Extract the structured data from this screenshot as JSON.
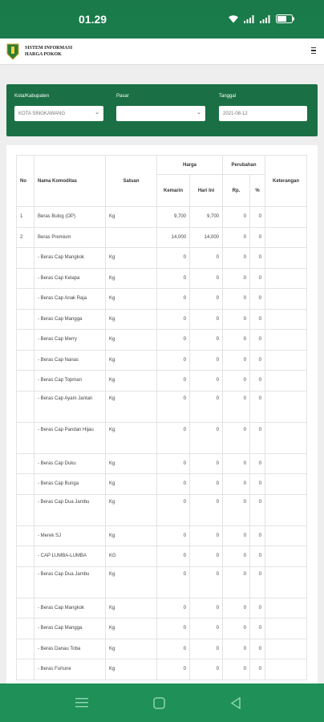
{
  "status_bar": {
    "time": "01.29"
  },
  "header": {
    "brand_line1": "SISTEM INFORMASI",
    "brand_line2": "HARGA POKOK"
  },
  "filters": {
    "kota_label": "Kota/Kabupaten",
    "kota_value": "KOTA SINGKAWANG",
    "pasar_label": "Pasar",
    "pasar_value": "",
    "tanggal_label": "Tanggal",
    "tanggal_value": "2021-08-12"
  },
  "table": {
    "headers": {
      "no": "No",
      "nama": "Nama Komoditas",
      "satuan": "Satuan",
      "harga": "Harga",
      "kemarin": "Kemarin",
      "hari_ini": "Hari Ini",
      "perubahan": "Perubahan",
      "rp": "Rp.",
      "pct": "%",
      "keterangan": "Keterangan"
    },
    "rows": [
      {
        "no": "1",
        "nama": "Beras Bulog (OP)",
        "satuan": "Kg",
        "kemarin": "9,700",
        "hari_ini": "9,700",
        "rp": "0",
        "pct": "0"
      },
      {
        "no": "2",
        "nama": "Beras Premium",
        "satuan": "",
        "kemarin": "14,000",
        "hari_ini": "14,000",
        "rp": "0",
        "pct": "0"
      },
      {
        "no": "",
        "nama": "- Beras Cap Mangkok",
        "satuan": "Kg",
        "kemarin": "0",
        "hari_ini": "0",
        "rp": "0",
        "pct": "0"
      },
      {
        "no": "",
        "nama": "- Beras Cap Kelapa",
        "satuan": "Kg",
        "kemarin": "0",
        "hari_ini": "0",
        "rp": "0",
        "pct": "0"
      },
      {
        "no": "",
        "nama": "- Beras Cap Anak Raja",
        "satuan": "Kg",
        "kemarin": "0",
        "hari_ini": "0",
        "rp": "0",
        "pct": "0"
      },
      {
        "no": "",
        "nama": "- Beras Cap Mangga",
        "satuan": "Kg",
        "kemarin": "0",
        "hari_ini": "0",
        "rp": "0",
        "pct": "0"
      },
      {
        "no": "",
        "nama": "- Beras Cap Merry",
        "satuan": "Kg",
        "kemarin": "0",
        "hari_ini": "0",
        "rp": "0",
        "pct": "0"
      },
      {
        "no": "",
        "nama": "- Beras Cap Nanas",
        "satuan": "Kg",
        "kemarin": "0",
        "hari_ini": "0",
        "rp": "0",
        "pct": "0"
      },
      {
        "no": "",
        "nama": "- Beras Cap Topman",
        "satuan": "Kg",
        "kemarin": "0",
        "hari_ini": "0",
        "rp": "0",
        "pct": "0"
      },
      {
        "no": "",
        "nama": "- Beras Cap Ayam Jantan",
        "satuan": "Kg",
        "kemarin": "0",
        "hari_ini": "0",
        "rp": "0",
        "pct": "0",
        "tall": true
      },
      {
        "no": "",
        "nama": "- Beras Cap Pandan Hijau",
        "satuan": "Kg",
        "kemarin": "0",
        "hari_ini": "0",
        "rp": "0",
        "pct": "0",
        "tall": true
      },
      {
        "no": "",
        "nama": "- Beras Cap Duku",
        "satuan": "Kg",
        "kemarin": "0",
        "hari_ini": "0",
        "rp": "0",
        "pct": "0"
      },
      {
        "no": "",
        "nama": "- Beras Cap Bunga",
        "satuan": "Kg",
        "kemarin": "0",
        "hari_ini": "0",
        "rp": "0",
        "pct": "0"
      },
      {
        "no": "",
        "nama": "- Beras Cap Dua Jambu",
        "satuan": "Kg",
        "kemarin": "0",
        "hari_ini": "0",
        "rp": "0",
        "pct": "0",
        "tall": true
      },
      {
        "no": "",
        "nama": "- Merek SJ",
        "satuan": "Kg",
        "kemarin": "0",
        "hari_ini": "0",
        "rp": "0",
        "pct": "0"
      },
      {
        "no": "",
        "nama": "- CAP LUMBA-LUMBA",
        "satuan": "KG",
        "kemarin": "0",
        "hari_ini": "0",
        "rp": "0",
        "pct": "0"
      },
      {
        "no": "",
        "nama": "- Beras Cap Dua Jambu",
        "satuan": "Kg",
        "kemarin": "0",
        "hari_ini": "0",
        "rp": "0",
        "pct": "0",
        "tall": true
      },
      {
        "no": "",
        "nama": "- Beras Cap Mangkok",
        "satuan": "Kg",
        "kemarin": "0",
        "hari_ini": "0",
        "rp": "0",
        "pct": "0"
      },
      {
        "no": "",
        "nama": "- Beras Cap Mangga",
        "satuan": "Kg",
        "kemarin": "0",
        "hari_ini": "0",
        "rp": "0",
        "pct": "0"
      },
      {
        "no": "",
        "nama": "- Beras Danau Toba",
        "satuan": "Kg",
        "kemarin": "0",
        "hari_ini": "0",
        "rp": "0",
        "pct": "0"
      },
      {
        "no": "",
        "nama": "- Beras Fortune",
        "satuan": "Kg",
        "kemarin": "0",
        "hari_ini": "0",
        "rp": "0",
        "pct": "0"
      }
    ]
  },
  "colors": {
    "primary": "#1a7044",
    "status_bg": "#1d8a54"
  }
}
